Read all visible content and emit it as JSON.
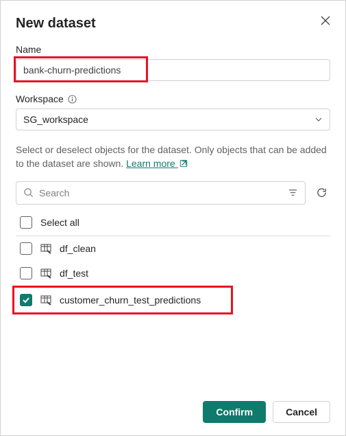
{
  "title": "New dataset",
  "name_label": "Name",
  "name_value": "bank-churn-predictions",
  "workspace_label": "Workspace",
  "workspace_value": "SG_workspace",
  "helper_text_1": "Select or deselect objects for the dataset. Only objects that can be added to the dataset are shown. ",
  "learn_more": "Learn more ",
  "search_placeholder": "Search",
  "select_all_label": "Select all",
  "items": [
    {
      "label": "df_clean",
      "checked": false
    },
    {
      "label": "df_test",
      "checked": false
    },
    {
      "label": "customer_churn_test_predictions",
      "checked": true
    }
  ],
  "confirm_label": "Confirm",
  "cancel_label": "Cancel"
}
